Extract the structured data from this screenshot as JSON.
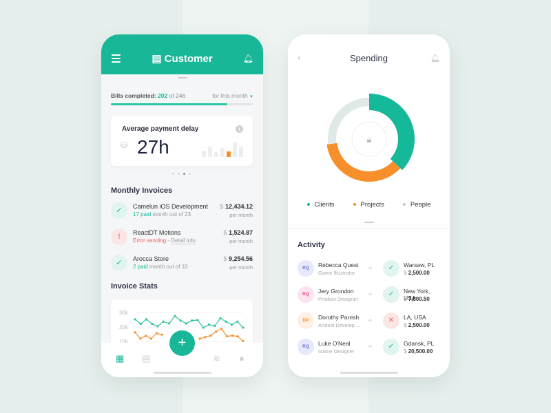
{
  "colors": {
    "accent": "#17b797",
    "orange": "#f7902b",
    "people": "#dfe9e7",
    "error": "#ee5c5c"
  },
  "customer": {
    "title": "Customer",
    "bills_label": "Bills completed:",
    "bills_done": "202",
    "bills_of": "of 246",
    "bills_progress": 0.82,
    "period": "for this month",
    "delay": {
      "title": "Average payment delay",
      "value": "27h",
      "bars": [
        0.4,
        0.7,
        0.3,
        0.6,
        0.35,
        0.95,
        0.7
      ],
      "highlight_index": 4
    },
    "carousel": {
      "count": 4,
      "active": 2
    },
    "invoices_title": "Monthly Invoices",
    "invoices": [
      {
        "name": "Camelun iOS Development",
        "status": "ok",
        "paid": "17 paid",
        "rest": "month out of 23",
        "currency": "$",
        "amount": "12,434.12",
        "per": "per month"
      },
      {
        "name": "ReactDT Motions",
        "status": "error",
        "error": "Error sending",
        "sep": " - ",
        "link": "Detail info",
        "currency": "$",
        "amount": "1,524.87",
        "per": "per month"
      },
      {
        "name": "Arocca Store",
        "status": "ok",
        "paid": "2 paid",
        "rest": "month out of 10",
        "currency": "$",
        "amount": "9,254.56",
        "per": "per month"
      }
    ],
    "stats_title": "Invoice Stats",
    "chart_data": {
      "type": "line",
      "y_ticks": [
        "30k",
        "20k",
        "10k"
      ],
      "ylim": [
        10,
        30
      ],
      "series": [
        {
          "color": "#2ec4a0",
          "values": [
            25.3,
            22.1,
            25.3,
            22.1,
            20.5,
            23.7,
            22.4,
            27.6,
            24.4,
            22.4,
            24.4,
            24.8,
            19.5,
            21.6,
            20.8,
            26,
            23.7,
            21.6,
            23.7,
            19.5
          ]
        },
        {
          "color": "#f7902b",
          "values": [
            16.3,
            11.9,
            13.9,
            11.9,
            15.6,
            14.7,
            null,
            null,
            null,
            null,
            null,
            null,
            11.9,
            13,
            14,
            16.8,
            18.7,
            13.5,
            14,
            13.5,
            10.3
          ]
        }
      ]
    },
    "nav": [
      "dashboard-icon",
      "archive-icon",
      "add-icon",
      "layers-icon",
      "user-icon"
    ],
    "fab": "+"
  },
  "spending": {
    "title": "Spending",
    "segments": [
      {
        "name": "Clients",
        "share": 0.37,
        "color": "#15b898"
      },
      {
        "name": "Projects",
        "share": 0.36,
        "color": "#f7902b"
      },
      {
        "name": "People",
        "share": 0.27,
        "color": "#dfe9e7"
      }
    ],
    "activity_title": "Activity",
    "activity": [
      {
        "initials": "RQ",
        "name": "Rebecca Quest",
        "role": "Game Illustrator",
        "status": "ok",
        "location": "Warsaw, PL",
        "currency": "$",
        "amount": "2,500.00",
        "avbg": "#e6e8fb",
        "avfg": "#6b74c9"
      },
      {
        "initials": "RQ",
        "name": "Jery Grondon",
        "role": "Product Designer",
        "status": "ok",
        "location": "New York, USA",
        "currency": "$",
        "amount": "7,800.50",
        "avbg": "#fde2ef",
        "avfg": "#e0468f"
      },
      {
        "initials": "DP",
        "name": "Dorothy Parrish",
        "role": "Andoid Develop ...",
        "status": "error",
        "location": "LA, USA",
        "currency": "$",
        "amount": "2,500.00",
        "avbg": "#fff0e2",
        "avfg": "#f7902b"
      },
      {
        "initials": "RQ",
        "name": "Luke O'Neal",
        "role": "Game Designer",
        "status": "ok",
        "location": "Gdansk, PL",
        "currency": "$",
        "amount": "20,500.00",
        "avbg": "#e6e8fb",
        "avfg": "#6b74c9"
      }
    ]
  }
}
